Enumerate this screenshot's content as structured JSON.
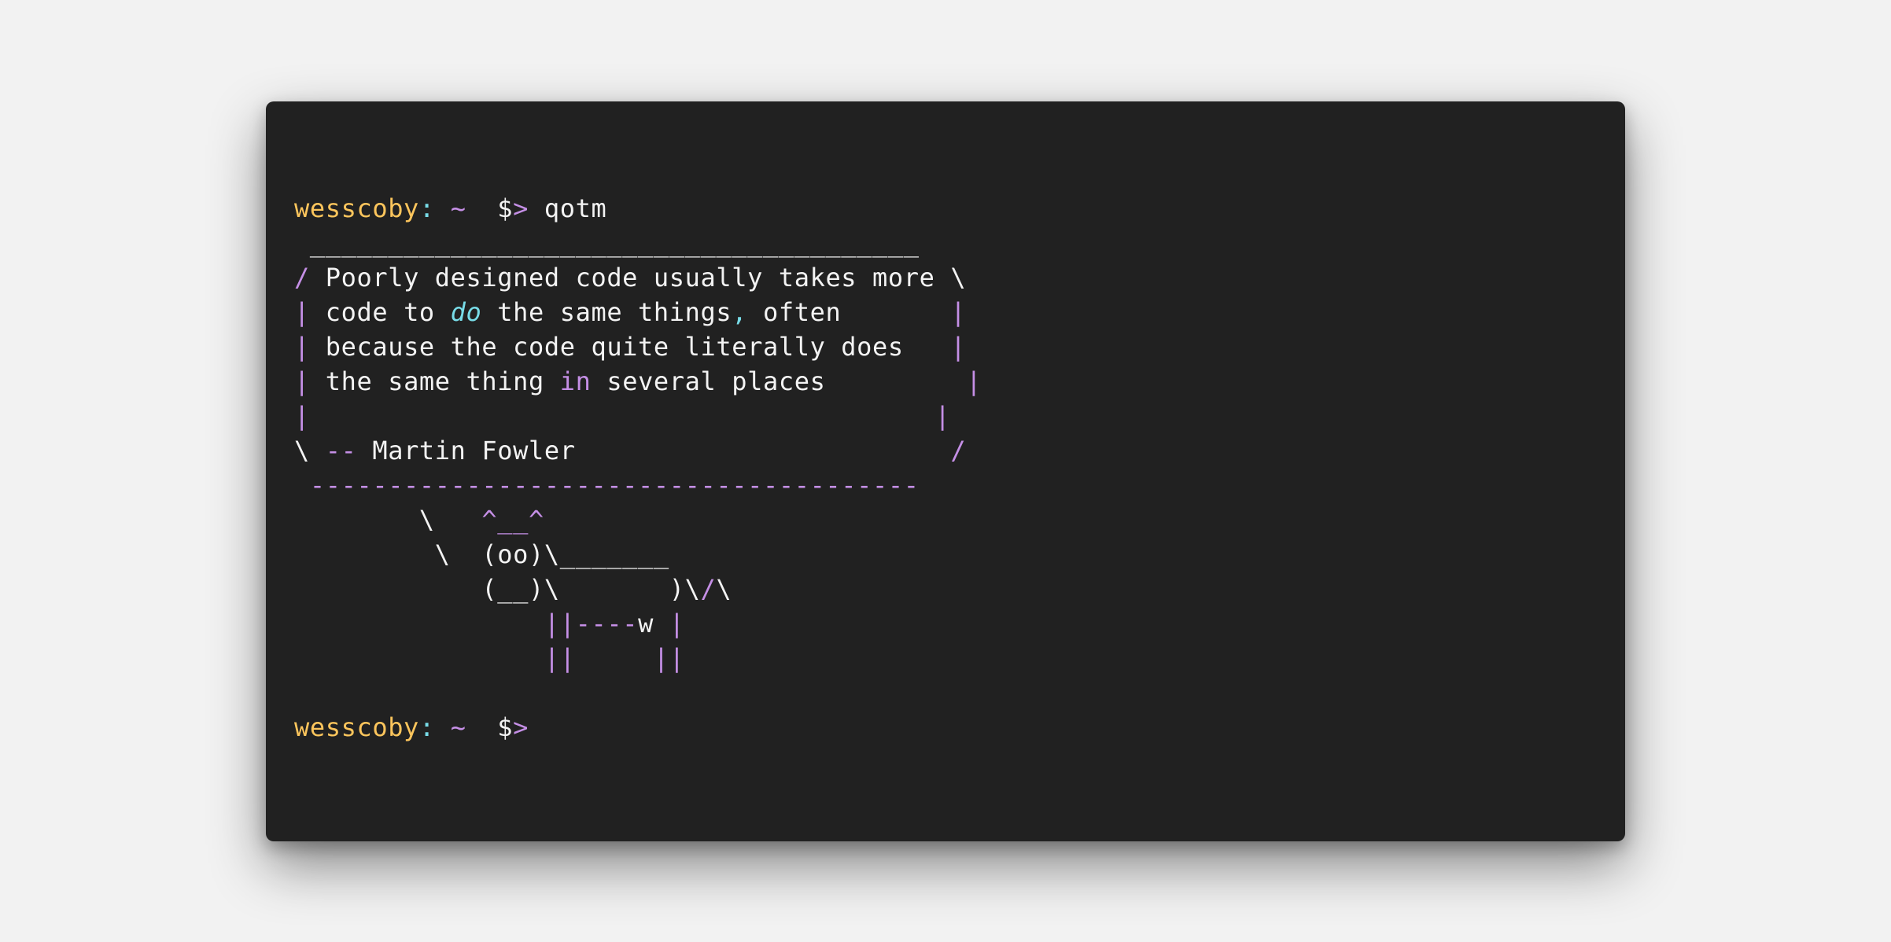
{
  "prompt": {
    "user": "wesscoby",
    "sep": ":",
    "path": "~",
    "dollar": "$",
    "arrow": ">"
  },
  "command": "qotm",
  "quote": {
    "top_border": " _______________________________________",
    "bottom_border": " ---------------------------------------",
    "line1": " Poorly designed code usually takes more ",
    "line2_a": " code to ",
    "line2_em": "do",
    "line2_b": " the same things",
    "line2_comma": ",",
    "line2_c": " often       ",
    "line3": " because the code quite literally does   ",
    "line4_a": " the same thing ",
    "line4_kw": "in",
    "line4_b": " several places         ",
    "line5": "                                        ",
    "attr_dash": "--",
    "attr_name": " Martin Fowler                        "
  },
  "cow": {
    "l1_a": "        \\   ",
    "l1_b": "^__^",
    "l2": "         \\  (oo)\\_______",
    "l3_a": "            (__)\\       )\\",
    "l3_slash": "/",
    "l3_b": "\\",
    "l4_a": "                ",
    "l4_legs": "||",
    "l4_dash": "----",
    "l4_w": "w ",
    "l4_bar": "|",
    "l5_a": "                ",
    "l5_legs1": "||",
    "l5_sp": "     ",
    "l5_legs2": "||"
  }
}
